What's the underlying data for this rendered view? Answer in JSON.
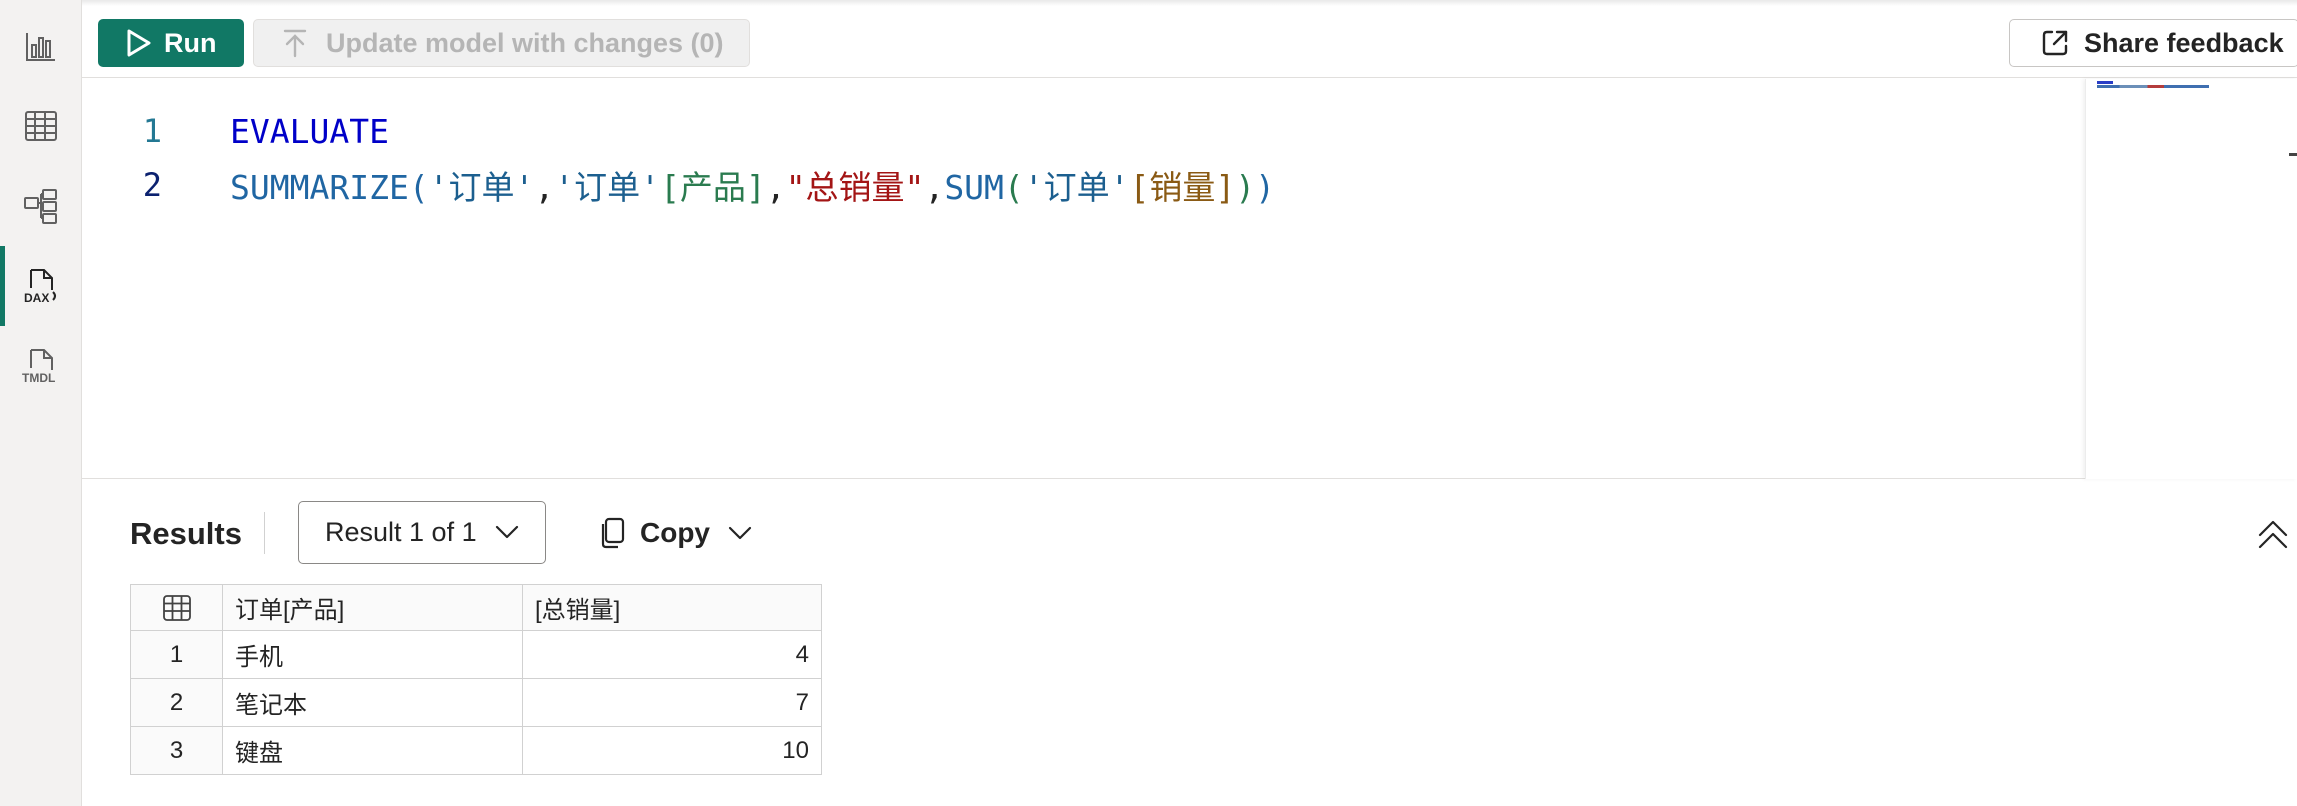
{
  "sidebar": {
    "items": [
      {
        "name": "report-view",
        "icon": "bar-chart-icon",
        "active": false
      },
      {
        "name": "table-view",
        "icon": "table-grid-icon",
        "active": false
      },
      {
        "name": "model-view",
        "icon": "model-hierarchy-icon",
        "active": false
      },
      {
        "name": "dax-query-view",
        "icon": "dax-file-icon",
        "label": "DAX",
        "active": true
      },
      {
        "name": "tmdl-view",
        "icon": "tmdl-file-icon",
        "label": "TMDL",
        "active": false
      }
    ],
    "accent": "#117865"
  },
  "toolbar": {
    "run_label": "Run",
    "update_label": "Update model with changes (0)",
    "feedback_label": "Share feedback"
  },
  "editor": {
    "lines": [
      {
        "number": "1",
        "text": "EVALUATE"
      },
      {
        "number": "2",
        "text": "SUMMARIZE('订单','订单'[产品],\"总销量\",SUM('订单'[销量]))"
      }
    ],
    "tokens": {
      "evaluate": "EVALUATE",
      "summarize": "SUMMARIZE",
      "table1": "'订单'",
      "table2": "'订单'",
      "col1": "[产品]",
      "literal": "\"总销量\"",
      "sum": "SUM",
      "table3": "'订单'",
      "col2": "[销量]"
    }
  },
  "results": {
    "title": "Results",
    "selector": "Result 1 of 1",
    "copy_label": "Copy",
    "columns": [
      "订单[产品]",
      "[总销量]"
    ],
    "rows": [
      {
        "index": "1",
        "product": "手机",
        "total": "4"
      },
      {
        "index": "2",
        "product": "笔记本",
        "total": "7"
      },
      {
        "index": "3",
        "product": "键盘",
        "total": "10"
      }
    ]
  }
}
